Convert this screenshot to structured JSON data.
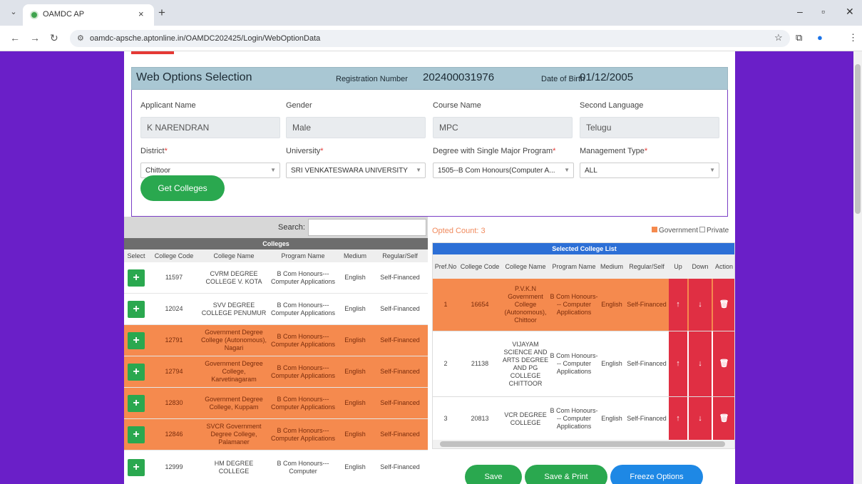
{
  "browser": {
    "tab_title": "OAMDC AP",
    "tab_close": "×",
    "new_tab": "+",
    "url": "oamdc-apsche.aptonline.in/OAMDC202425/Login/WebOptionData",
    "icons": [
      "menu-chevron-icon",
      "back-arrow-icon",
      "forward-arrow-icon",
      "reload-icon",
      "site-info-icon",
      "bookmark-star-icon",
      "extensions-icon",
      "profile-icon",
      "kebab-menu-icon",
      "minimize-icon",
      "restore-icon",
      "close-window-icon"
    ]
  },
  "header": {
    "title": "Web Options Selection",
    "registration_label": "Registration Number",
    "registration_value": "202400031976",
    "dob_label": "Date of Birth",
    "dob_value": "01/12/2005"
  },
  "form": {
    "applicant_name_label": "Applicant Name",
    "applicant_name": "K NARENDRAN",
    "gender_label": "Gender",
    "gender": "Male",
    "course_label": "Course Name",
    "course": "MPC",
    "second_language_label": "Second Language",
    "second_language": "Telugu",
    "district_label": "District",
    "district": "Chittoor",
    "university_label": "University",
    "university": "SRI VENKATESWARA UNIVERSITY",
    "degree_label": "Degree with Single Major Program",
    "degree": "1505--B Com Honours(Computer A...",
    "management_label": "Management Type",
    "management": "ALL",
    "required_mark": "*",
    "get_colleges": "Get Colleges"
  },
  "colleges": {
    "search_label": "Search:",
    "title": "Colleges",
    "columns": [
      "Select",
      "College Code",
      "College Name",
      "Program Name",
      "Medium",
      "Regular/Self"
    ],
    "add_label": "+",
    "rows": [
      {
        "code": "11597",
        "name": "CVRM DEGREE COLLEGE V. KOTA",
        "program": "B Com Honours--- Computer Applications",
        "medium": "English",
        "type": "Self-Financed",
        "govt": false
      },
      {
        "code": "12024",
        "name": "SVV DEGREE COLLEGE PENUMUR",
        "program": "B Com Honours--- Computer Applications",
        "medium": "English",
        "type": "Self-Financed",
        "govt": false
      },
      {
        "code": "12791",
        "name": "Government Degree College (Autonomous), Nagari",
        "program": "B Com Honours--- Computer Applications",
        "medium": "English",
        "type": "Self-Financed",
        "govt": true
      },
      {
        "code": "12794",
        "name": "Government Degree College, Karvetinagaram",
        "program": "B Com Honours--- Computer Applications",
        "medium": "English",
        "type": "Self-Financed",
        "govt": true
      },
      {
        "code": "12830",
        "name": "Government Degree College, Kuppam",
        "program": "B Com Honours--- Computer Applications",
        "medium": "English",
        "type": "Self-Financed",
        "govt": true
      },
      {
        "code": "12846",
        "name": "SVCR Government Degree College, Palamaner",
        "program": "B Com Honours--- Computer Applications",
        "medium": "English",
        "type": "Self-Financed",
        "govt": true
      },
      {
        "code": "12999",
        "name": "HM DEGREE COLLEGE",
        "program": "B Com Honours--- Computer",
        "medium": "English",
        "type": "Self-Financed",
        "govt": false
      }
    ]
  },
  "selected": {
    "opted_count": "Opted Count: 3",
    "legend_govt": "Government",
    "legend_private": "Private",
    "title": "Selected College List",
    "columns": [
      "Pref.No",
      "College Code",
      "College Name",
      "Program Name",
      "Medium",
      "Regular/Self",
      "Up",
      "Down",
      "Action"
    ],
    "up_label": "↑",
    "down_label": "↓",
    "delete_label": "🗑",
    "rows": [
      {
        "pref": "1",
        "code": "16654",
        "name": "P.V.K.N Government College (Autonomous), Chittoor",
        "program": "B Com Honours--- Computer Applications",
        "medium": "English",
        "type": "Self-Financed",
        "govt": true
      },
      {
        "pref": "2",
        "code": "21138",
        "name": "VIJAYAM SCIENCE AND ARTS DEGREE AND PG COLLEGE CHITTOOR",
        "program": "B Com Honours--- Computer Applications",
        "medium": "English",
        "type": "Self-Financed",
        "govt": false
      },
      {
        "pref": "3",
        "code": "20813",
        "name": "VCR DEGREE COLLEGE",
        "program": "B Com Honours--- Computer Applications",
        "medium": "English",
        "type": "Self-Financed",
        "govt": false
      }
    ]
  },
  "actions": {
    "save": "Save",
    "save_print": "Save & Print",
    "freeze": "Freeze Options"
  },
  "colors": {
    "page_bg": "#6a1fc8",
    "header_bg": "#a9c7d3",
    "govt_row": "#f58a4e",
    "green": "#2aa84f",
    "blue": "#1e88e5",
    "red": "#e02f43",
    "sel_title": "#2c6fd6"
  }
}
